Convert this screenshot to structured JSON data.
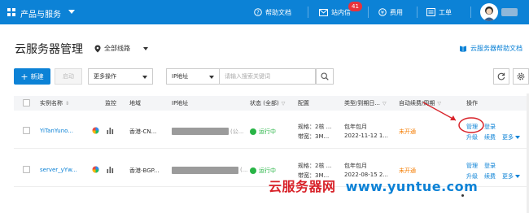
{
  "topbar": {
    "brand_label": "产品与服务",
    "help_docs": "帮助文档",
    "messages": "站内信",
    "messages_badge": "41",
    "billing": "费用",
    "tickets": "工单",
    "accent": "#0c82d6"
  },
  "page": {
    "title": "云服务器管理",
    "region": "全部线路",
    "help_link": "云服务器帮助文档"
  },
  "toolbar": {
    "new_label": "新建",
    "start_label": "启动",
    "more_ops": "更多操作",
    "ip_select": "IP地址",
    "search_placeholder": "请输入搜索关键词"
  },
  "table": {
    "headers": {
      "name": "实例名称",
      "monitor": "监控",
      "region": "地域",
      "ip": "IP地址",
      "status": "状态 (全部)",
      "config": "配置",
      "type": "类型/到期日...",
      "renew": "自动续费/周期",
      "ops": "操作"
    },
    "rows": [
      {
        "name": "YiTanYuno...",
        "region": "香港-CN...",
        "ip_suffix": "(公...",
        "status": "运行中",
        "config_spec": "规格：2核 ...",
        "config_bw": "带宽：3M...",
        "type": "包年包月",
        "expiry": "2022-11-12 1...",
        "renew": "未开通",
        "op_manage": "管理",
        "op_login": "登录",
        "op_upgrade": "升级",
        "op_renew": "续费",
        "op_more": "更多"
      },
      {
        "name": "server_yYw...",
        "region": "香港-BGP...",
        "ip_suffix": "(...",
        "status": "运行中",
        "config_spec": "规格：2核 ...",
        "config_bw": "带宽：3M...",
        "type": "包年包月",
        "expiry": "2022-08-15 2...",
        "renew": "未开通",
        "op_manage": "管理",
        "op_login": "登录",
        "op_upgrade": "升级",
        "op_renew": "续费",
        "op_more": "更多"
      }
    ]
  },
  "watermark": {
    "cn": "云服务器网",
    "url": "www.yuntue.com"
  }
}
